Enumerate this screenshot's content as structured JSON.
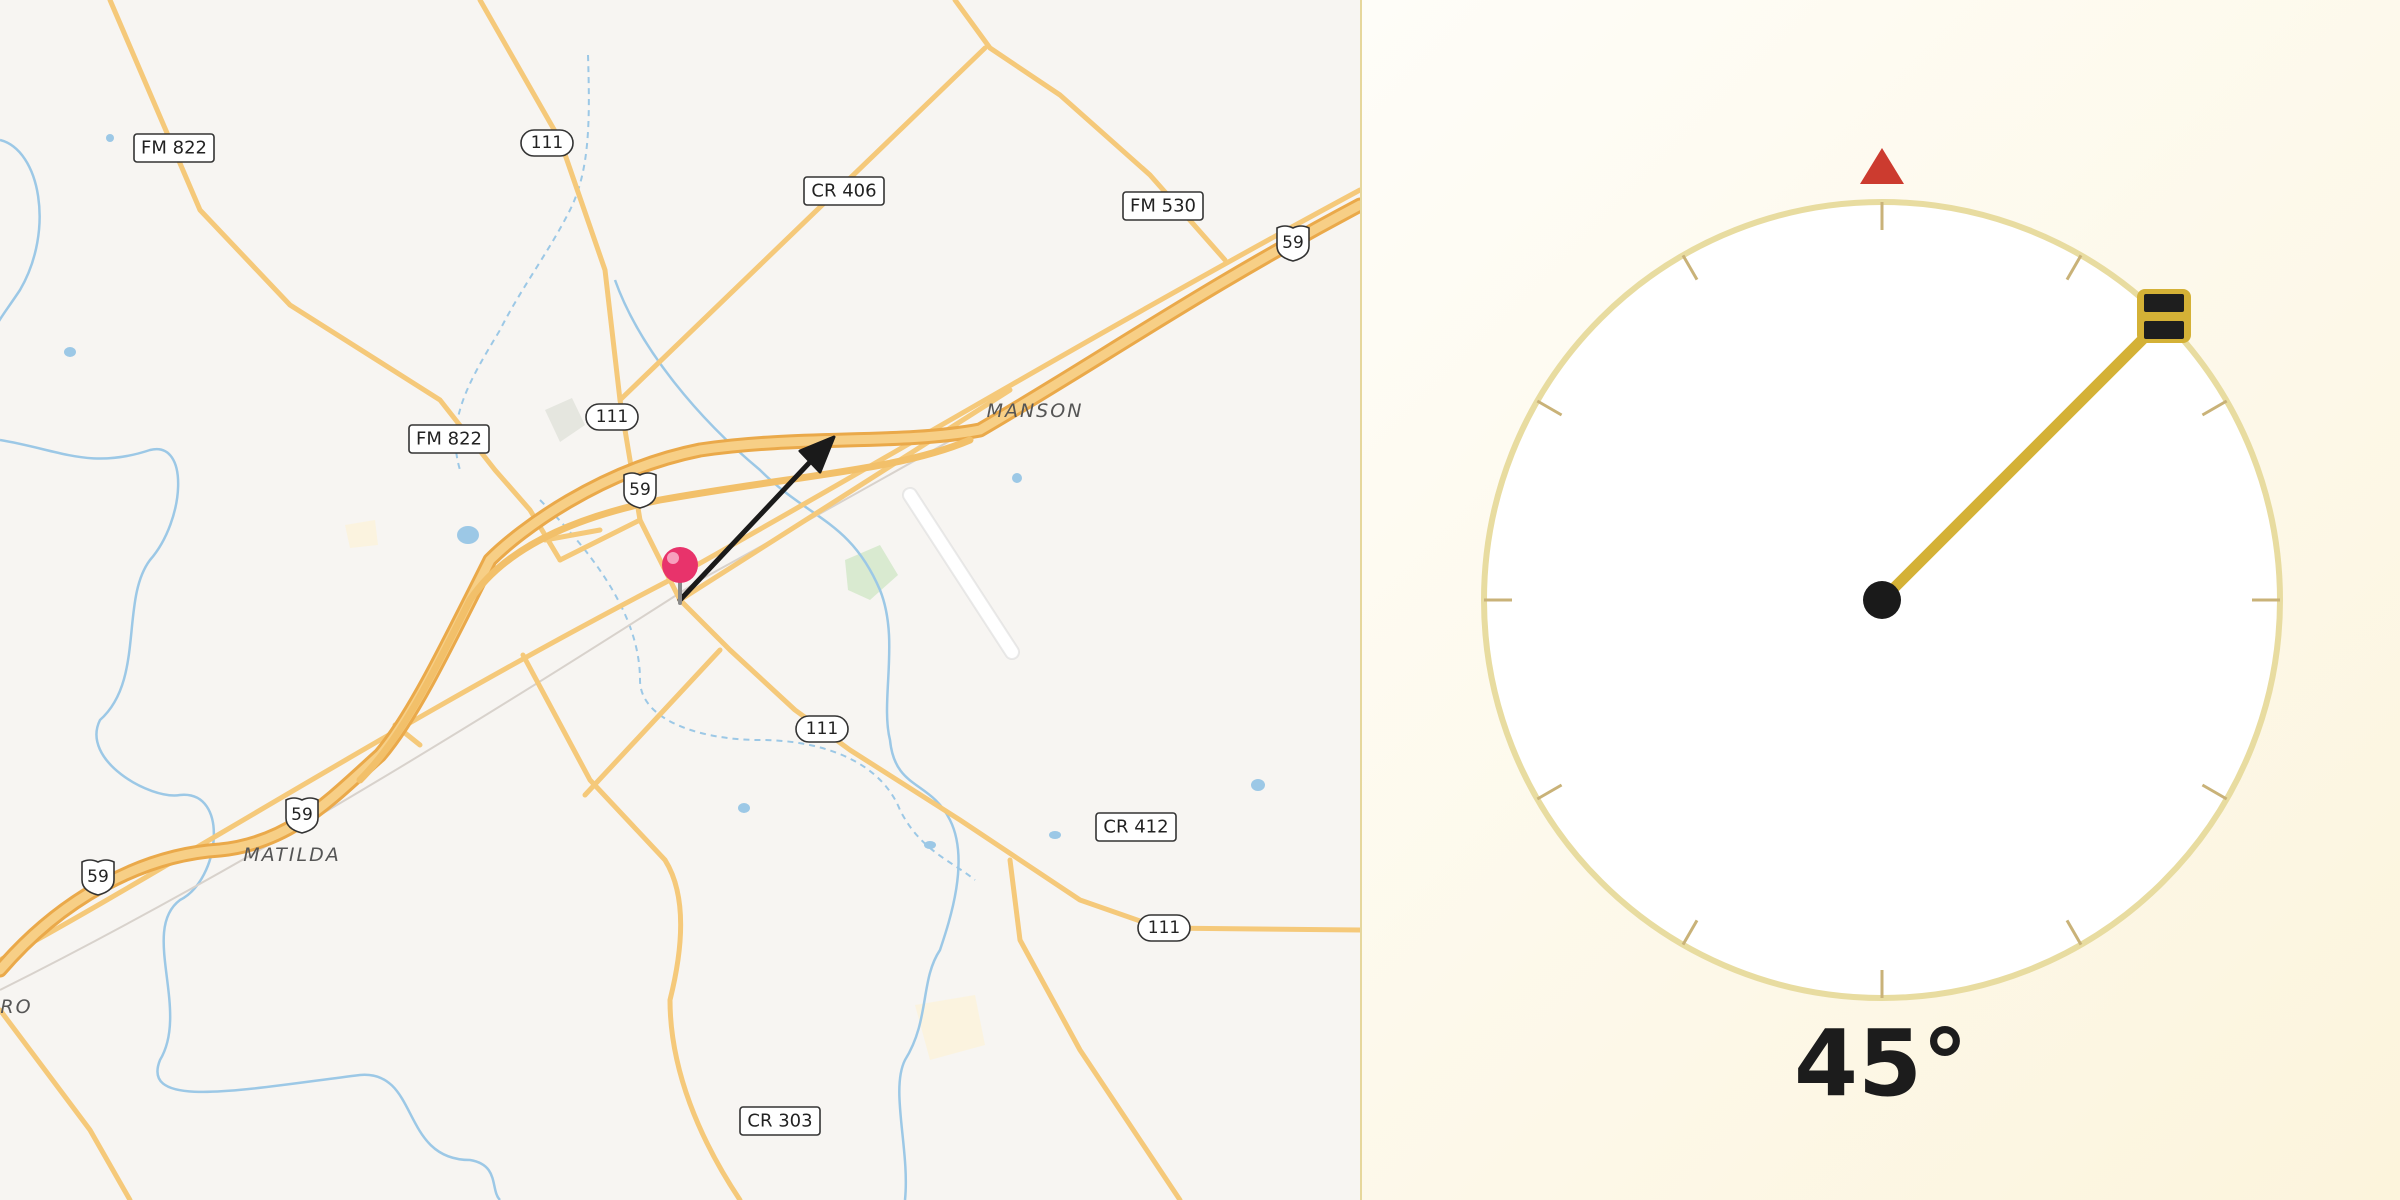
{
  "map": {
    "towns": [
      {
        "name": "MANSON"
      },
      {
        "name": "MATILDA"
      },
      {
        "name": "ORO"
      }
    ],
    "road_labels": [
      {
        "text": "FM 822",
        "kind": "box"
      },
      {
        "text": "111",
        "kind": "oval"
      },
      {
        "text": "CR 406",
        "kind": "box"
      },
      {
        "text": "FM 530",
        "kind": "box"
      },
      {
        "text": "59",
        "kind": "us-shield"
      },
      {
        "text": "111",
        "kind": "oval"
      },
      {
        "text": "FM 822",
        "kind": "box"
      },
      {
        "text": "59",
        "kind": "us-shield"
      },
      {
        "text": "111",
        "kind": "oval"
      },
      {
        "text": "CR 412",
        "kind": "box"
      },
      {
        "text": "59",
        "kind": "us-shield"
      },
      {
        "text": "59",
        "kind": "us-shield"
      },
      {
        "text": "111",
        "kind": "oval"
      },
      {
        "text": "CR 303",
        "kind": "box"
      }
    ],
    "marker": {
      "icon": "map-pin-icon",
      "color": "#e8336b"
    },
    "direction_arrow": {
      "icon": "direction-arrow-icon",
      "color": "#1a1a1a"
    },
    "colors": {
      "road": "#f5c97a",
      "highway": "#f2b35c",
      "water": "#9cc8e6",
      "land": "#f7f5f2"
    }
  },
  "compass": {
    "angle_label": "45°",
    "heading_degrees": 45,
    "north_icon": "north-triangle-icon",
    "handle_icon": "drag-handle-icon",
    "colors": {
      "needle": "#d4b136",
      "ring": "#e8dca0",
      "north": "#cc3b2f",
      "hub": "#1a1a1a"
    }
  }
}
